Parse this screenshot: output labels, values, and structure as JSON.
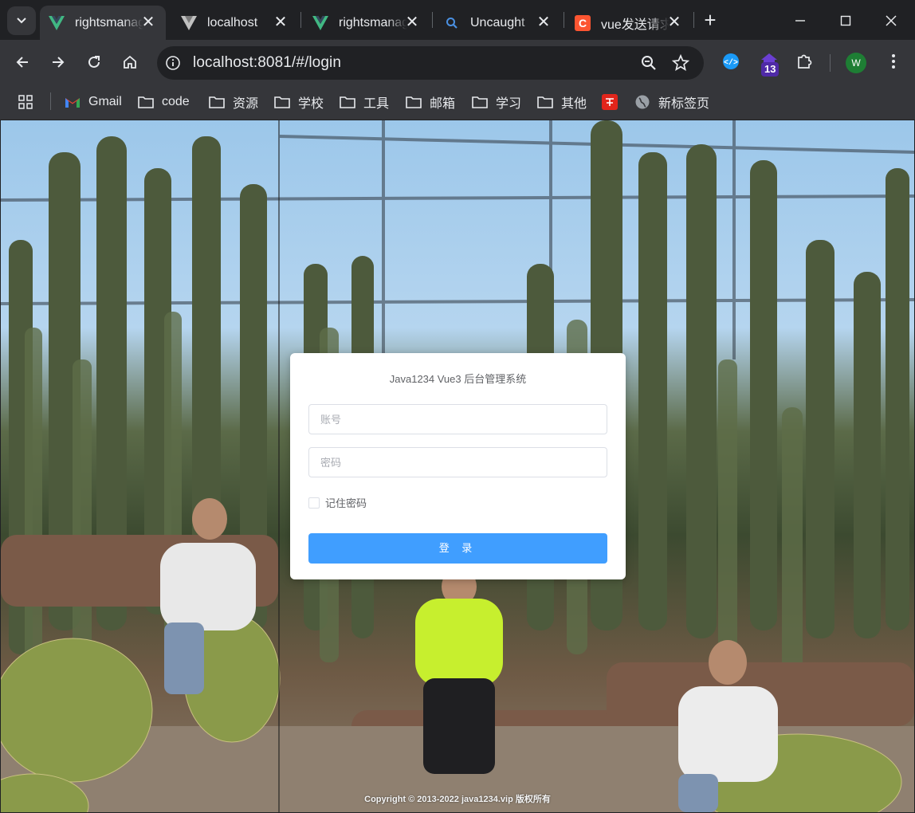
{
  "browser": {
    "tabs": [
      {
        "title": "rightsmanager",
        "favicon": "vue-logo-icon",
        "active": true
      },
      {
        "title": "localhost",
        "favicon": "vite-logo-icon",
        "active": false
      },
      {
        "title": "rightsmanager",
        "favicon": "vue-logo-icon",
        "active": false
      },
      {
        "title": "Uncaught",
        "favicon": "search-icon",
        "active": false
      },
      {
        "title": "vue发送请求",
        "favicon": "csdn-logo-icon",
        "active": false
      }
    ],
    "url": "localhost:8081/#/login",
    "extension_badge": "13",
    "profile_initial": "W",
    "bookmarks": [
      {
        "label": "Gmail",
        "icon": "gmail-icon"
      },
      {
        "label": "code",
        "icon": "folder-icon"
      },
      {
        "label": "资源",
        "icon": "folder-icon"
      },
      {
        "label": "学校",
        "icon": "folder-icon"
      },
      {
        "label": "工具",
        "icon": "folder-icon"
      },
      {
        "label": "邮箱",
        "icon": "folder-icon"
      },
      {
        "label": "学习",
        "icon": "folder-icon"
      },
      {
        "label": "其他",
        "icon": "folder-icon"
      },
      {
        "label": "",
        "icon": "red-app-icon"
      },
      {
        "label": "新标签页",
        "icon": "globe-icon"
      }
    ]
  },
  "login": {
    "title": "Java1234 Vue3 后台管理系统",
    "username_placeholder": "账号",
    "password_placeholder": "密码",
    "remember_label": "记住密码",
    "submit_label": "登 录"
  },
  "footer": {
    "copyright": "Copyright © 2013-2022 java1234.vip 版权所有"
  },
  "colors": {
    "primary_button": "#409eff",
    "chrome_dark": "#202124",
    "chrome_toolbar": "#35363a"
  }
}
